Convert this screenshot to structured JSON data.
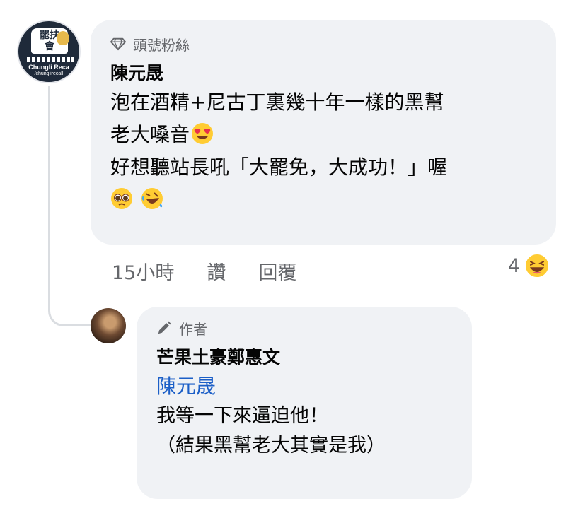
{
  "page_avatar": {
    "logo_text": "罷扶會",
    "name": "Chungli Reca",
    "handle": "/chunglirecall"
  },
  "comment": {
    "badge_label": "頭號粉絲",
    "badge_icon": "diamond-icon",
    "author": "陳元晟",
    "lines": [
      "泡在酒精+尼古丁裏幾十年一樣的黑幫",
      "老大嗓音",
      "好想聽站長吼「大罷免，大成功！」喔"
    ],
    "emojis": [
      "heart-eyes-emoji",
      "pleading-emoji",
      "rolling-laughing-emoji"
    ],
    "time": "15小時",
    "like_label": "讚",
    "reply_label": "回覆",
    "reaction_count": "4",
    "reaction_icon": "haha-emoji"
  },
  "reply": {
    "badge_label": "作者",
    "badge_icon": "pencil-icon",
    "author": "芒果土豪鄭惠文",
    "mention": "陳元晟",
    "lines": [
      "我等一下來逼迫他！",
      "（結果黑幫老大其實是我）"
    ]
  },
  "colors": {
    "bubble": "#f0f2f5",
    "meta_text": "#65676b",
    "mention": "#1c5fc7",
    "thread_line": "#dadde1"
  }
}
